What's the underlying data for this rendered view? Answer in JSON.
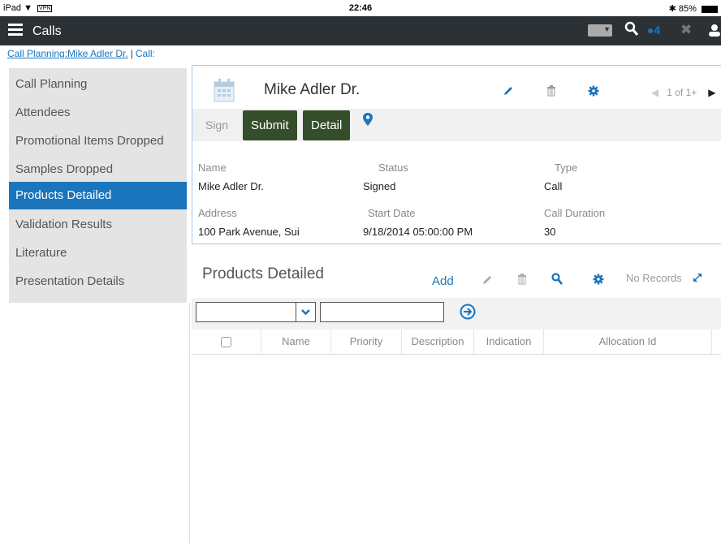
{
  "status_bar": {
    "device": "iPad",
    "vpn": "VPN",
    "time": "22:46",
    "battery": "85%"
  },
  "navbar": {
    "title": "Calls",
    "badge_count": "4"
  },
  "breadcrumb": {
    "item1": "Call Planning:Mike Adler Dr.",
    "separator": "|",
    "item2": "Call:"
  },
  "sidebar": {
    "items": [
      {
        "label": "Call Planning"
      },
      {
        "label": "Attendees"
      },
      {
        "label": "Promotional Items Dropped"
      },
      {
        "label": "Samples Dropped"
      },
      {
        "label": "Products Detailed"
      },
      {
        "label": "Validation Results"
      },
      {
        "label": "Literature"
      },
      {
        "label": "Presentation Details"
      }
    ],
    "active_index": 4
  },
  "record": {
    "title": "Mike Adler Dr.",
    "pager": "1 of 1+",
    "buttons": {
      "sign": "Sign",
      "submit": "Submit",
      "detail": "Detail"
    },
    "fields": {
      "name_label": "Name",
      "name_value": "Mike Adler Dr.",
      "status_label": "Status",
      "status_value": "Signed",
      "type_label": "Type",
      "type_value": "Call",
      "address_label": "Address",
      "address_value": "100 Park Avenue, Sui",
      "start_label": "Start Date",
      "start_value": "9/18/2014 05:00:00 PM",
      "duration_label": "Call Duration",
      "duration_value": "30"
    }
  },
  "products_detailed": {
    "title": "Products Detailed",
    "add_label": "Add",
    "no_records": "No Records",
    "columns": [
      "Name",
      "Priority",
      "Description",
      "Indication",
      "Allocation Id"
    ]
  },
  "colors": {
    "accent": "#1b75bc",
    "nav_bg": "#2c3136",
    "button_green": "#354e2a"
  }
}
